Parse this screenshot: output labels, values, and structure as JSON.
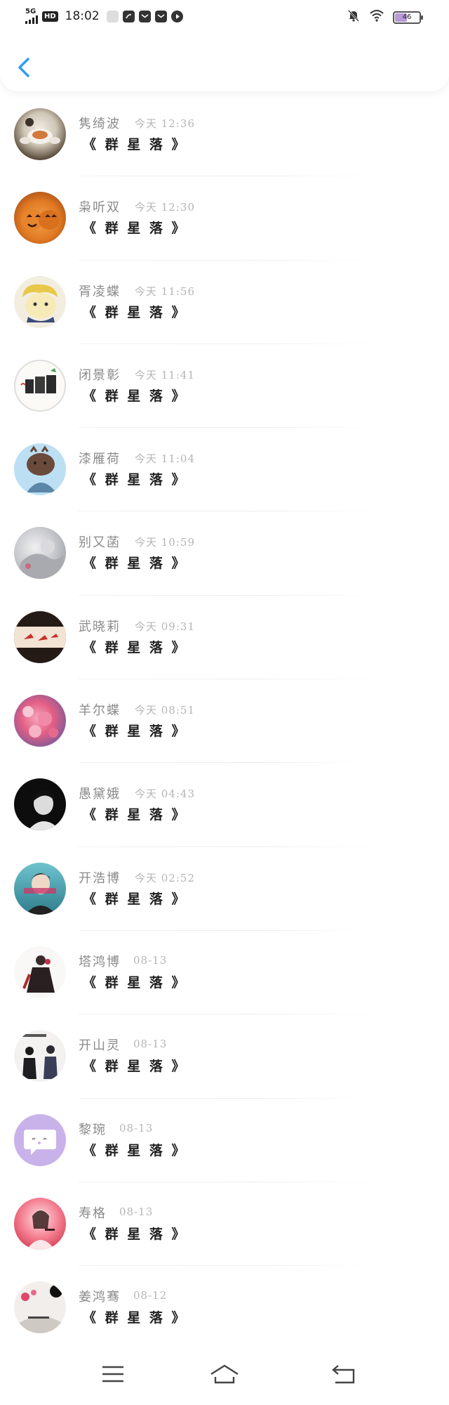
{
  "status_bar": {
    "network": "5G",
    "hd": "HD",
    "time": "18:02",
    "battery": "46",
    "battery_level": 0.46,
    "icons": [
      "signal-icon",
      "hd-icon",
      "app-icon-1",
      "app-icon-2",
      "mail-icon",
      "mail-icon",
      "play-icon",
      "mute-bell-icon",
      "wifi-icon",
      "battery-icon"
    ]
  },
  "header": {
    "back_icon": "chevron-left-icon"
  },
  "contacts": [
    {
      "name": "隽绮波",
      "time": "今天 12:36",
      "message": "《 群 星 落 》"
    },
    {
      "name": "枭听双",
      "time": "今天 12:30",
      "message": "《 群 星 落 》"
    },
    {
      "name": "胥凌蝶",
      "time": "今天 11:56",
      "message": "《 群 星 落 》"
    },
    {
      "name": "闭景彰",
      "time": "今天 11:41",
      "message": "《 群 星 落 》"
    },
    {
      "name": "漆雁荷",
      "time": "今天 11:04",
      "message": "《 群 星 落 》"
    },
    {
      "name": "别又菡",
      "time": "今天 10:59",
      "message": "《 群 星 落 》"
    },
    {
      "name": "武晓莉",
      "time": "今天 09:31",
      "message": "《 群 星 落 》"
    },
    {
      "name": "羊尔蝶",
      "time": "今天 08:51",
      "message": "《 群 星 落 》"
    },
    {
      "name": "愚黛娥",
      "time": "今天 04:43",
      "message": "《 群 星 落 》"
    },
    {
      "name": "开浩博",
      "time": "今天 02:52",
      "message": "《 群 星 落 》"
    },
    {
      "name": "塔鸿博",
      "time": "08-13",
      "message": "《 群 星 落 》"
    },
    {
      "name": "开山灵",
      "time": "08-13",
      "message": "《 群 星 落 》"
    },
    {
      "name": "黎琬",
      "time": "08-13",
      "message": "《 群 星 落 》"
    },
    {
      "name": "寿格",
      "time": "08-13",
      "message": "《 群 星 落 》"
    },
    {
      "name": "姜鸿骞",
      "time": "08-12",
      "message": "《 群 星 落 》"
    }
  ],
  "nav_bar": {
    "icons": [
      "menu-icon",
      "home-icon",
      "back-icon"
    ]
  },
  "colors": {
    "back_accent": "#2a9df4",
    "name": "#8a8a8a",
    "time": "#b5b5b5",
    "message": "#222222"
  }
}
